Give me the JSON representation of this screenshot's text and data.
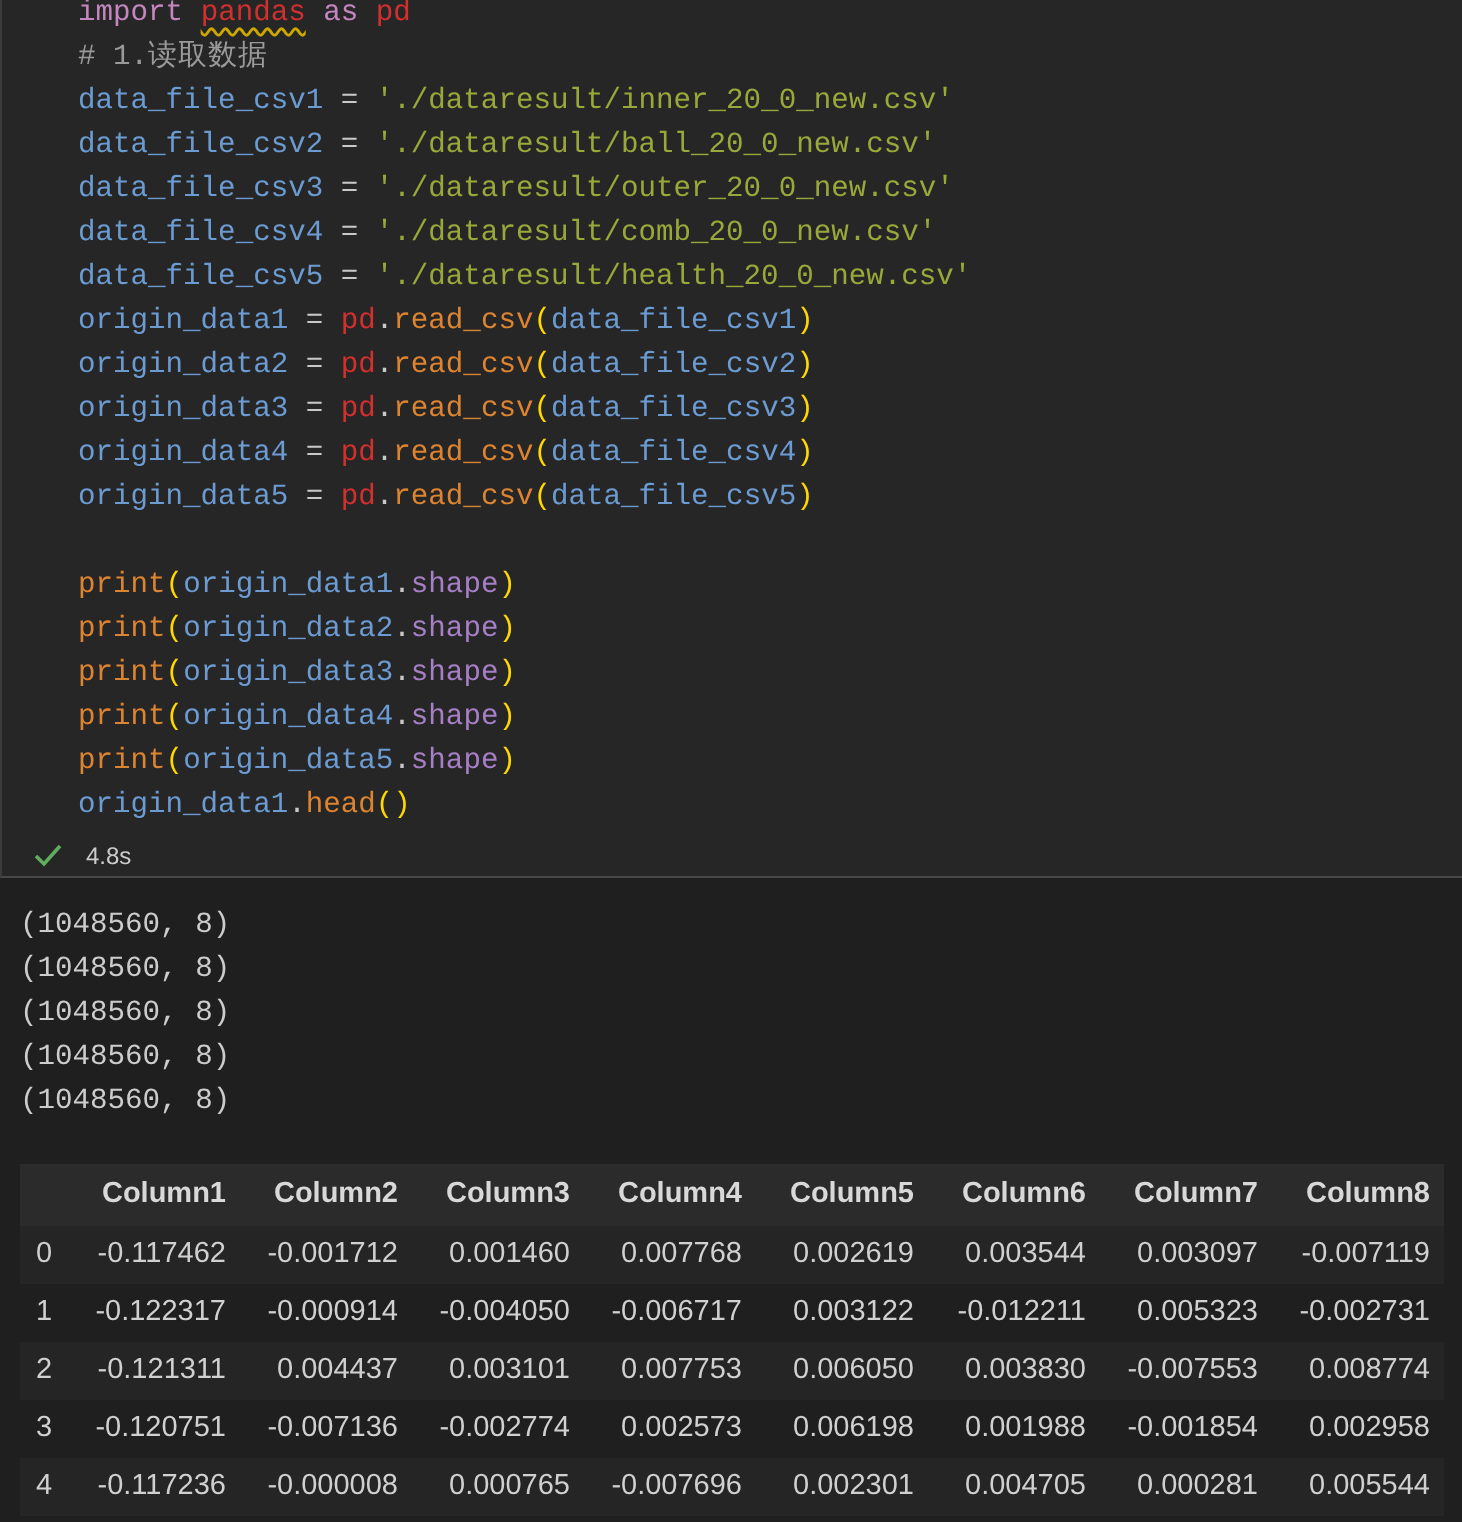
{
  "code_cell": {
    "lines": [
      {
        "tokens": [
          {
            "text": "import ",
            "kind": "keyword"
          },
          {
            "text": "pandas",
            "kind": "module",
            "warning": true
          },
          {
            "text": " as ",
            "kind": "keyword"
          },
          {
            "text": "pd",
            "kind": "module"
          }
        ]
      },
      {
        "tokens": [
          {
            "text": "# 1.读取数据",
            "kind": "comment"
          }
        ]
      },
      {
        "tokens": [
          {
            "text": "data_file_csv1",
            "kind": "variable"
          },
          {
            "text": " = ",
            "kind": "operator"
          },
          {
            "text": "'./dataresult/inner_20_0_new.csv'",
            "kind": "string"
          }
        ]
      },
      {
        "tokens": [
          {
            "text": "data_file_csv2",
            "kind": "variable"
          },
          {
            "text": " = ",
            "kind": "operator"
          },
          {
            "text": "'./dataresult/ball_20_0_new.csv'",
            "kind": "string"
          }
        ]
      },
      {
        "tokens": [
          {
            "text": "data_file_csv3",
            "kind": "variable"
          },
          {
            "text": " = ",
            "kind": "operator"
          },
          {
            "text": "'./dataresult/outer_20_0_new.csv'",
            "kind": "string"
          }
        ]
      },
      {
        "tokens": [
          {
            "text": "data_file_csv4",
            "kind": "variable"
          },
          {
            "text": " = ",
            "kind": "operator"
          },
          {
            "text": "'./dataresult/comb_20_0_new.csv'",
            "kind": "string"
          }
        ]
      },
      {
        "tokens": [
          {
            "text": "data_file_csv5",
            "kind": "variable"
          },
          {
            "text": " = ",
            "kind": "operator"
          },
          {
            "text": "'./dataresult/health_20_0_new.csv'",
            "kind": "string"
          }
        ]
      },
      {
        "tokens": [
          {
            "text": "origin_data1",
            "kind": "variable"
          },
          {
            "text": " = ",
            "kind": "operator"
          },
          {
            "text": "pd",
            "kind": "module"
          },
          {
            "text": ".",
            "kind": "operator"
          },
          {
            "text": "read_csv",
            "kind": "function"
          },
          {
            "text": "(",
            "kind": "paren"
          },
          {
            "text": "data_file_csv1",
            "kind": "variable"
          },
          {
            "text": ")",
            "kind": "paren"
          }
        ]
      },
      {
        "tokens": [
          {
            "text": "origin_data2",
            "kind": "variable"
          },
          {
            "text": " = ",
            "kind": "operator"
          },
          {
            "text": "pd",
            "kind": "module"
          },
          {
            "text": ".",
            "kind": "operator"
          },
          {
            "text": "read_csv",
            "kind": "function"
          },
          {
            "text": "(",
            "kind": "paren"
          },
          {
            "text": "data_file_csv2",
            "kind": "variable"
          },
          {
            "text": ")",
            "kind": "paren"
          }
        ]
      },
      {
        "tokens": [
          {
            "text": "origin_data3",
            "kind": "variable"
          },
          {
            "text": " = ",
            "kind": "operator"
          },
          {
            "text": "pd",
            "kind": "module"
          },
          {
            "text": ".",
            "kind": "operator"
          },
          {
            "text": "read_csv",
            "kind": "function"
          },
          {
            "text": "(",
            "kind": "paren"
          },
          {
            "text": "data_file_csv3",
            "kind": "variable"
          },
          {
            "text": ")",
            "kind": "paren"
          }
        ]
      },
      {
        "tokens": [
          {
            "text": "origin_data4",
            "kind": "variable"
          },
          {
            "text": " = ",
            "kind": "operator"
          },
          {
            "text": "pd",
            "kind": "module"
          },
          {
            "text": ".",
            "kind": "operator"
          },
          {
            "text": "read_csv",
            "kind": "function"
          },
          {
            "text": "(",
            "kind": "paren"
          },
          {
            "text": "data_file_csv4",
            "kind": "variable"
          },
          {
            "text": ")",
            "kind": "paren"
          }
        ]
      },
      {
        "tokens": [
          {
            "text": "origin_data5",
            "kind": "variable"
          },
          {
            "text": " = ",
            "kind": "operator"
          },
          {
            "text": "pd",
            "kind": "module"
          },
          {
            "text": ".",
            "kind": "operator"
          },
          {
            "text": "read_csv",
            "kind": "function"
          },
          {
            "text": "(",
            "kind": "paren"
          },
          {
            "text": "data_file_csv5",
            "kind": "variable"
          },
          {
            "text": ")",
            "kind": "paren"
          }
        ]
      },
      {
        "gap_before": true,
        "tokens": [
          {
            "text": "print",
            "kind": "function"
          },
          {
            "text": "(",
            "kind": "paren"
          },
          {
            "text": "origin_data1",
            "kind": "variable"
          },
          {
            "text": ".",
            "kind": "operator"
          },
          {
            "text": "shape",
            "kind": "attribute"
          },
          {
            "text": ")",
            "kind": "paren"
          }
        ]
      },
      {
        "tokens": [
          {
            "text": "print",
            "kind": "function"
          },
          {
            "text": "(",
            "kind": "paren"
          },
          {
            "text": "origin_data2",
            "kind": "variable"
          },
          {
            "text": ".",
            "kind": "operator"
          },
          {
            "text": "shape",
            "kind": "attribute"
          },
          {
            "text": ")",
            "kind": "paren"
          }
        ]
      },
      {
        "tokens": [
          {
            "text": "print",
            "kind": "function"
          },
          {
            "text": "(",
            "kind": "paren"
          },
          {
            "text": "origin_data3",
            "kind": "variable"
          },
          {
            "text": ".",
            "kind": "operator"
          },
          {
            "text": "shape",
            "kind": "attribute"
          },
          {
            "text": ")",
            "kind": "paren"
          }
        ]
      },
      {
        "tokens": [
          {
            "text": "print",
            "kind": "function"
          },
          {
            "text": "(",
            "kind": "paren"
          },
          {
            "text": "origin_data4",
            "kind": "variable"
          },
          {
            "text": ".",
            "kind": "operator"
          },
          {
            "text": "shape",
            "kind": "attribute"
          },
          {
            "text": ")",
            "kind": "paren"
          }
        ]
      },
      {
        "tokens": [
          {
            "text": "print",
            "kind": "function"
          },
          {
            "text": "(",
            "kind": "paren"
          },
          {
            "text": "origin_data5",
            "kind": "variable"
          },
          {
            "text": ".",
            "kind": "operator"
          },
          {
            "text": "shape",
            "kind": "attribute"
          },
          {
            "text": ")",
            "kind": "paren"
          }
        ]
      },
      {
        "tokens": [
          {
            "text": "origin_data1",
            "kind": "variable"
          },
          {
            "text": ".",
            "kind": "operator"
          },
          {
            "text": "head",
            "kind": "function"
          },
          {
            "text": "()",
            "kind": "paren"
          }
        ]
      }
    ],
    "status": {
      "succeeded": true,
      "duration": "4.8s"
    }
  },
  "output": {
    "lines": [
      "(1048560, 8)",
      "(1048560, 8)",
      "(1048560, 8)",
      "(1048560, 8)",
      "(1048560, 8)"
    ],
    "table": {
      "columns": [
        "Column1",
        "Column2",
        "Column3",
        "Column4",
        "Column5",
        "Column6",
        "Column7",
        "Column8"
      ],
      "rows": [
        {
          "index": "0",
          "values": [
            "-0.117462",
            "-0.001712",
            "0.001460",
            "0.007768",
            "0.002619",
            "0.003544",
            "0.003097",
            "-0.007119"
          ]
        },
        {
          "index": "1",
          "values": [
            "-0.122317",
            "-0.000914",
            "-0.004050",
            "-0.006717",
            "0.003122",
            "-0.012211",
            "0.005323",
            "-0.002731"
          ]
        },
        {
          "index": "2",
          "values": [
            "-0.121311",
            "0.004437",
            "0.003101",
            "0.007753",
            "0.006050",
            "0.003830",
            "-0.007553",
            "0.008774"
          ]
        },
        {
          "index": "3",
          "values": [
            "-0.120751",
            "-0.007136",
            "-0.002774",
            "0.002573",
            "0.006198",
            "0.001988",
            "-0.001854",
            "0.002958"
          ]
        },
        {
          "index": "4",
          "values": [
            "-0.117236",
            "-0.000008",
            "0.000765",
            "-0.007696",
            "0.002301",
            "0.004705",
            "0.000281",
            "0.005544"
          ]
        }
      ]
    }
  }
}
